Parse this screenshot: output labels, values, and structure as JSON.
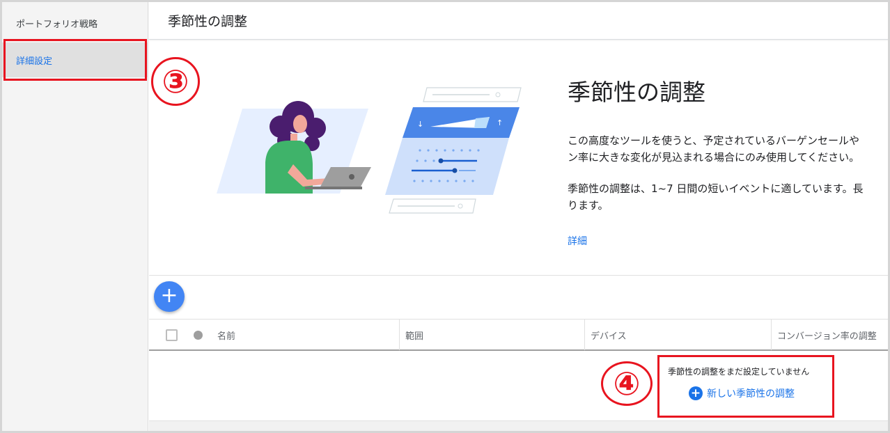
{
  "sidebar": {
    "items": [
      {
        "label": "ポートフォリオ戦略"
      },
      {
        "label": "詳細設定"
      }
    ]
  },
  "header": {
    "title": "季節性の調整"
  },
  "annotations": {
    "step3": "③",
    "step4": "④"
  },
  "intro": {
    "title": "季節性の調整",
    "p1_line1": "この高度なツールを使うと、予定されているバーゲンセールや",
    "p1_line2": "ン率に大きな変化が見込まれる場合にのみ使用してください。",
    "p2_line1": "季節性の調整は、1~7 日間の短いイベントに適しています。長",
    "p2_line2": "ります。",
    "link": "詳細"
  },
  "fab": {
    "icon": "plus-icon",
    "label": "+"
  },
  "table": {
    "columns": [
      "名前",
      "範囲",
      "デバイス",
      "コンバージョン率の調整"
    ]
  },
  "empty_state": {
    "message": "季節性の調整をまだ設定していません",
    "action": "新しい季節性の調整",
    "action_icon": "+"
  },
  "colors": {
    "accent": "#1a73e8",
    "fab": "#4285f4",
    "annotation_red": "#e8141f",
    "sidebar_bg": "#f4f4f4",
    "selected_bg": "#e0e0e0"
  }
}
